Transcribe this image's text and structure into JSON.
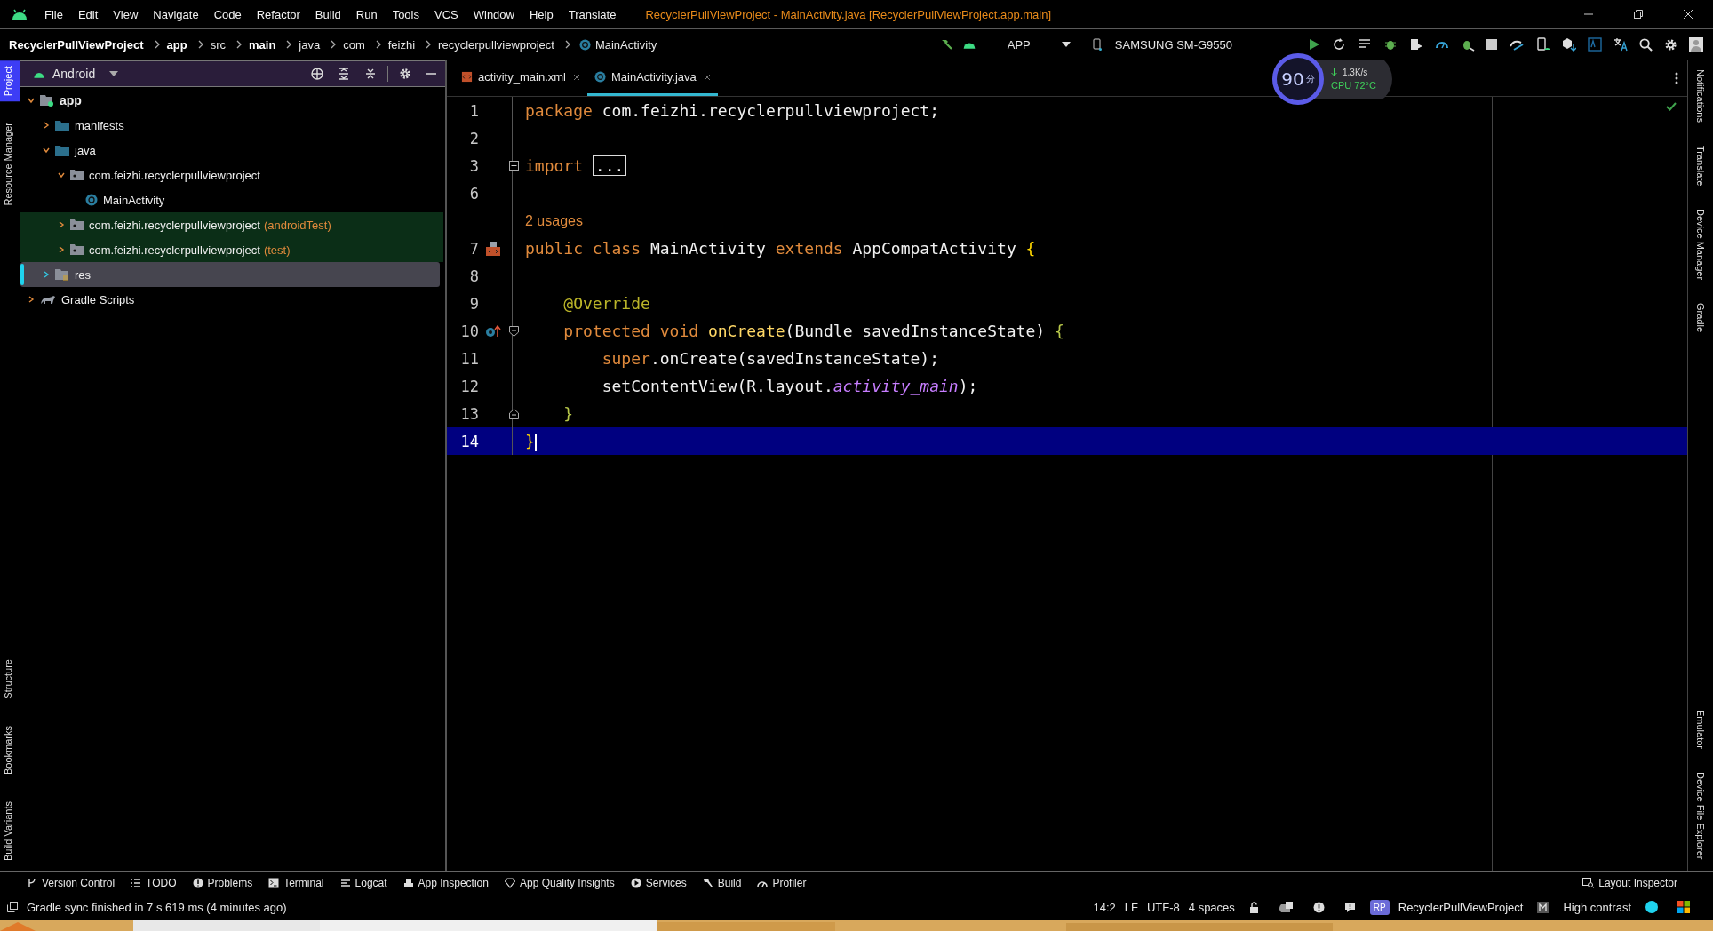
{
  "menu": {
    "items": [
      "File",
      "Edit",
      "View",
      "Navigate",
      "Code",
      "Refactor",
      "Build",
      "Run",
      "Tools",
      "VCS",
      "Window",
      "Help",
      "Translate"
    ],
    "title": "RecyclerPullViewProject - MainActivity.java [RecyclerPullViewProject.app.main]"
  },
  "breadcrumbs": [
    {
      "label": "RecyclerPullViewProject",
      "bold": true
    },
    {
      "label": "app",
      "bold": true
    },
    {
      "label": "src",
      "bold": false
    },
    {
      "label": "main",
      "bold": true
    },
    {
      "label": "java",
      "bold": false
    },
    {
      "label": "com",
      "bold": false
    },
    {
      "label": "feizhi",
      "bold": false
    },
    {
      "label": "recyclerpullviewproject",
      "bold": false
    },
    {
      "label": "MainActivity",
      "bold": false
    }
  ],
  "toolbar": {
    "run_config": "APP",
    "device": "SAMSUNG SM-G9550"
  },
  "monitor": {
    "score": "90",
    "unit": "分",
    "speed": "1.3K/s",
    "cpu": "CPU 72°C"
  },
  "left_strip": [
    {
      "label": "Project",
      "selected": true
    },
    {
      "label": "Resource Manager",
      "selected": false
    },
    {
      "label": "Structure",
      "selected": false
    },
    {
      "label": "Bookmarks",
      "selected": false
    },
    {
      "label": "Build Variants",
      "selected": false
    }
  ],
  "project_panel": {
    "view": "Android",
    "tree": [
      {
        "label": "app",
        "kind": "module",
        "expanded": true,
        "selected": false,
        "tinted": false,
        "children": [
          {
            "label": "manifests",
            "kind": "folder",
            "expanded": false,
            "selected": false,
            "tinted": false
          },
          {
            "label": "java",
            "kind": "folder",
            "expanded": true,
            "selected": false,
            "tinted": false,
            "children": [
              {
                "label": "com.feizhi.recyclerpullviewproject",
                "kind": "package",
                "expanded": true,
                "selected": false,
                "tinted": false,
                "children": [
                  {
                    "label": "MainActivity",
                    "kind": "class",
                    "selected": false,
                    "tinted": false
                  }
                ]
              },
              {
                "label": "com.feizhi.recyclerpullviewproject",
                "suffix": "(androidTest)",
                "kind": "package",
                "expanded": false,
                "selected": false,
                "tinted": true
              },
              {
                "label": "com.feizhi.recyclerpullviewproject",
                "suffix": "(test)",
                "kind": "package",
                "expanded": false,
                "selected": false,
                "tinted": true
              }
            ]
          },
          {
            "label": "res",
            "kind": "res",
            "expanded": false,
            "selected": true,
            "tinted": false
          }
        ]
      },
      {
        "label": "Gradle Scripts",
        "kind": "gradle",
        "expanded": false,
        "selected": false,
        "tinted": false
      }
    ]
  },
  "tabs": [
    {
      "label": "activity_main.xml",
      "kind": "xml",
      "selected": false
    },
    {
      "label": "MainActivity.java",
      "kind": "class",
      "selected": true
    }
  ],
  "code": [
    {
      "number": "1",
      "tokens": [
        {
          "text": "package ",
          "kind": "keyword"
        },
        {
          "text": "com.feizhi.recyclerpullviewproject;",
          "kind": "plain"
        }
      ]
    },
    {
      "number": "2"
    },
    {
      "number": "3",
      "collapsed": true,
      "tokens": [
        {
          "text": "import ",
          "kind": "keyword"
        },
        {
          "text": "...",
          "kind": "folded"
        }
      ]
    },
    {
      "number": "6"
    },
    {
      "kind": "inlay",
      "text": "2 usages"
    },
    {
      "number": "7",
      "linked_layout": true,
      "tokens": [
        {
          "text": "public class ",
          "kind": "keyword"
        },
        {
          "text": "MainActivity ",
          "kind": "plain"
        },
        {
          "text": "extends ",
          "kind": "keyword"
        },
        {
          "text": "AppCompatActivity ",
          "kind": "plain"
        },
        {
          "text": "{",
          "kind": "brace"
        }
      ]
    },
    {
      "number": "8"
    },
    {
      "number": "9",
      "tokens": [
        {
          "text": "    @Override",
          "kind": "annotation"
        }
      ]
    },
    {
      "number": "10",
      "overrides": true,
      "fold_start": true,
      "tokens": [
        {
          "text": "    protected void ",
          "kind": "keyword"
        },
        {
          "text": "onCreate",
          "kind": "method"
        },
        {
          "text": "(Bundle savedInstanceState) ",
          "kind": "plain"
        },
        {
          "text": "{",
          "kind": "brace2"
        }
      ]
    },
    {
      "number": "11",
      "tokens": [
        {
          "text": "        super",
          "kind": "keyword"
        },
        {
          "text": ".onCreate(savedInstanceState);",
          "kind": "plain"
        }
      ]
    },
    {
      "number": "12",
      "tokens": [
        {
          "text": "        setContentView(R.layout.",
          "kind": "plain"
        },
        {
          "text": "activity_main",
          "kind": "field"
        },
        {
          "text": ");",
          "kind": "plain"
        }
      ]
    },
    {
      "number": "13",
      "fold_end": true,
      "tokens": [
        {
          "text": "    }",
          "kind": "brace2"
        }
      ]
    },
    {
      "number": "14",
      "current": true,
      "tokens": [
        {
          "text": "}",
          "kind": "brace"
        }
      ]
    }
  ],
  "right_strip_top": [
    "Notifications",
    "Translate",
    "Device Manager",
    "Gradle"
  ],
  "right_strip_bottom": [
    "Emulator",
    "Device File Explorer"
  ],
  "tool_windows": [
    {
      "label": "Version Control",
      "kind": "vcs"
    },
    {
      "label": "TODO",
      "kind": "list"
    },
    {
      "label": "Problems",
      "kind": "alert"
    },
    {
      "label": "Terminal",
      "kind": "terminal"
    },
    {
      "label": "Logcat",
      "kind": "lines"
    },
    {
      "label": "App Inspection",
      "kind": "inspect"
    },
    {
      "label": "App Quality Insights",
      "kind": "diamond"
    },
    {
      "label": "Services",
      "kind": "play"
    },
    {
      "label": "Build",
      "kind": "hammer"
    },
    {
      "label": "Profiler",
      "kind": "gauge"
    }
  ],
  "layout_inspector": "Layout Inspector",
  "status": {
    "message": "Gradle sync finished in 7 s 619 ms (4 minutes ago)",
    "position": "14:2",
    "line_sep": "LF",
    "encoding": "UTF-8",
    "indent": "4 spaces",
    "badge": "RP",
    "project": "RecyclerPullViewProject",
    "theme": "High contrast"
  }
}
